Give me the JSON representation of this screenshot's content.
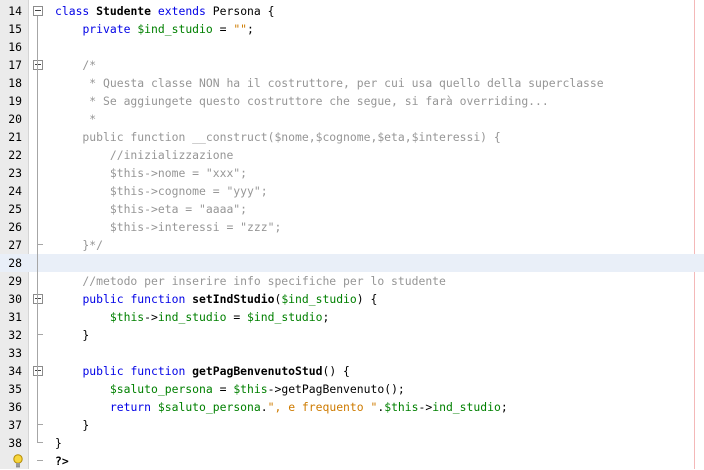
{
  "editor": {
    "lines": [
      {
        "n": "14",
        "fold": "open",
        "parts": [
          [
            "kw",
            "class "
          ],
          [
            "cls",
            "Studente "
          ],
          [
            "kw",
            "extends "
          ],
          [
            "t",
            "Persona {"
          ]
        ]
      },
      {
        "n": "15",
        "parts": [
          [
            "t",
            "    "
          ],
          [
            "kw",
            "private "
          ],
          [
            "var",
            "$ind_studio"
          ],
          [
            "t",
            " = "
          ],
          [
            "str",
            "\"\""
          ],
          [
            "t",
            ";"
          ]
        ]
      },
      {
        "n": "16",
        "parts": []
      },
      {
        "n": "17",
        "fold": "open",
        "parts": [
          [
            "cm",
            "    /*"
          ]
        ]
      },
      {
        "n": "18",
        "parts": [
          [
            "cm",
            "     * Questa classe NON ha il costruttore, per cui usa quello della superclasse"
          ]
        ]
      },
      {
        "n": "19",
        "parts": [
          [
            "cm",
            "     * Se aggiungete questo costruttore che segue, si farà overriding..."
          ]
        ]
      },
      {
        "n": "20",
        "parts": [
          [
            "cm",
            "     *"
          ]
        ]
      },
      {
        "n": "21",
        "parts": [
          [
            "cm",
            "    public function __construct($nome,$cognome,$eta,$interessi) {"
          ]
        ]
      },
      {
        "n": "22",
        "parts": [
          [
            "cm",
            "        //inizializzazione"
          ]
        ]
      },
      {
        "n": "23",
        "parts": [
          [
            "cm",
            "        $this->nome = \"xxx\";"
          ]
        ]
      },
      {
        "n": "24",
        "parts": [
          [
            "cm",
            "        $this->cognome = \"yyy\";"
          ]
        ]
      },
      {
        "n": "25",
        "parts": [
          [
            "cm",
            "        $this->eta = \"aaaa\";"
          ]
        ]
      },
      {
        "n": "26",
        "parts": [
          [
            "cm",
            "        $this->interessi = \"zzz\";"
          ]
        ]
      },
      {
        "n": "27",
        "fold": "end",
        "parts": [
          [
            "cm",
            "    }*/"
          ]
        ]
      },
      {
        "n": "28",
        "current": true,
        "parts": []
      },
      {
        "n": "29",
        "parts": [
          [
            "cm",
            "    //metodo per inserire info specifiche per lo studente"
          ]
        ]
      },
      {
        "n": "30",
        "fold": "open",
        "parts": [
          [
            "t",
            "    "
          ],
          [
            "kw",
            "public function "
          ],
          [
            "fn",
            "setIndStudio"
          ],
          [
            "t",
            "("
          ],
          [
            "var",
            "$ind_studio"
          ],
          [
            "t",
            ") {"
          ]
        ]
      },
      {
        "n": "31",
        "parts": [
          [
            "t",
            "        "
          ],
          [
            "var",
            "$this"
          ],
          [
            "t",
            "->"
          ],
          [
            "var",
            "ind_studio"
          ],
          [
            "t",
            " = "
          ],
          [
            "var",
            "$ind_studio"
          ],
          [
            "t",
            ";"
          ]
        ]
      },
      {
        "n": "32",
        "fold": "end",
        "parts": [
          [
            "t",
            "    }"
          ]
        ]
      },
      {
        "n": "33",
        "parts": []
      },
      {
        "n": "34",
        "fold": "open",
        "parts": [
          [
            "t",
            "    "
          ],
          [
            "kw",
            "public function "
          ],
          [
            "fn",
            "getPagBenvenutoStud"
          ],
          [
            "t",
            "() {"
          ]
        ]
      },
      {
        "n": "35",
        "parts": [
          [
            "t",
            "        "
          ],
          [
            "var",
            "$saluto_persona"
          ],
          [
            "t",
            " = "
          ],
          [
            "var",
            "$this"
          ],
          [
            "t",
            "->getPagBenvenuto();"
          ]
        ]
      },
      {
        "n": "36",
        "parts": [
          [
            "t",
            "        "
          ],
          [
            "kw",
            "return "
          ],
          [
            "var",
            "$saluto_persona"
          ],
          [
            "t",
            "."
          ],
          [
            "str",
            "\", e frequento \""
          ],
          [
            "t",
            "."
          ],
          [
            "var",
            "$this"
          ],
          [
            "t",
            "->"
          ],
          [
            "var",
            "ind_studio"
          ],
          [
            "t",
            ";"
          ]
        ]
      },
      {
        "n": "37",
        "fold": "end",
        "parts": [
          [
            "t",
            "    }"
          ]
        ]
      },
      {
        "n": "38",
        "fold": "end",
        "parts": [
          [
            "t",
            "}"
          ]
        ]
      },
      {
        "n": "",
        "fold": "end",
        "hint": "lightbulb-icon",
        "parts": [
          [
            "fn",
            "?>"
          ]
        ]
      }
    ],
    "colors": {
      "keyword": "#0000e6",
      "variable": "#008000",
      "string": "#ce7b00",
      "comment": "#969696",
      "current_line": "#e9eff8"
    }
  }
}
